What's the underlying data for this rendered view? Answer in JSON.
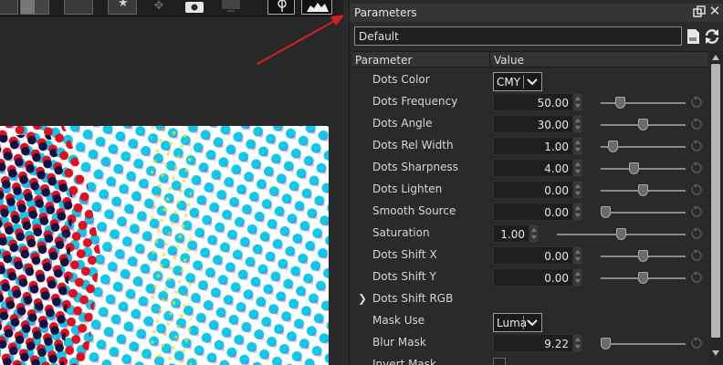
{
  "panel": {
    "title": "Parameters",
    "preset": "Default",
    "columns": {
      "parameter": "Parameter",
      "value": "Value"
    }
  },
  "parameters": [
    {
      "label": "Dots Color",
      "kind": "combo",
      "value": "CMY"
    },
    {
      "label": "Dots Frequency",
      "kind": "slider",
      "value": "50.00",
      "level": 0.2
    },
    {
      "label": "Dots Angle",
      "kind": "slider",
      "value": "30.00",
      "level": 0.5
    },
    {
      "label": "Dots Rel Width",
      "kind": "slider",
      "value": "1.00",
      "level": 0.1
    },
    {
      "label": "Dots Sharpness",
      "kind": "slider",
      "value": "4.00",
      "level": 0.38
    },
    {
      "label": "Dots Lighten",
      "kind": "slider",
      "value": "0.00",
      "level": 0.5
    },
    {
      "label": "Smooth Source",
      "kind": "slider",
      "value": "0.00",
      "level": 0.0
    },
    {
      "label": "Saturation",
      "kind": "slider-wide",
      "value": "1.00",
      "level": 0.5
    },
    {
      "label": "Dots Shift X",
      "kind": "slider",
      "value": "0.00",
      "level": 0.5
    },
    {
      "label": "Dots Shift Y",
      "kind": "slider",
      "value": "0.00",
      "level": 0.5
    },
    {
      "label": "Dots Shift RGB",
      "kind": "group"
    },
    {
      "label": "Mask Use",
      "kind": "combo",
      "value": "Luma"
    },
    {
      "label": "Blur Mask",
      "kind": "slider",
      "value": "9.22",
      "level": 0.0
    },
    {
      "label": "Invert Mask",
      "kind": "checkbox"
    }
  ],
  "icons": {
    "float": "float-window-icon",
    "close": "close-icon",
    "save": "save-preset-icon",
    "reload": "reload-icon",
    "reset": "reset-icon"
  },
  "colors": {
    "annotation_arrow": "#d42020",
    "scroll_thumb": "#b4b4b4"
  }
}
